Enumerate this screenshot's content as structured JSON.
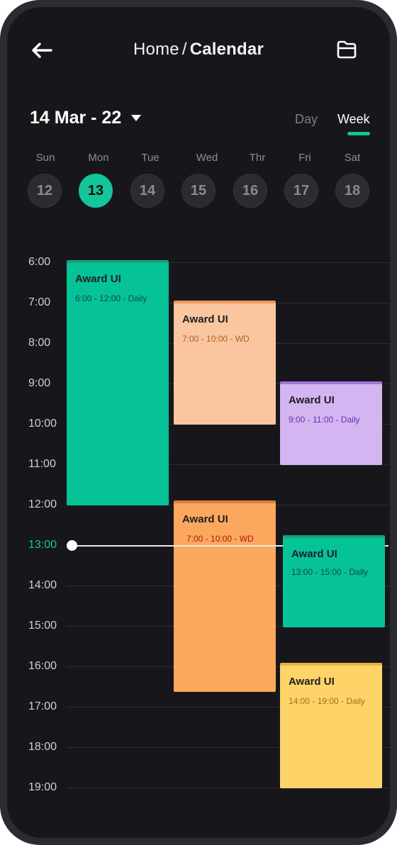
{
  "header": {
    "crumb_parent": "Home",
    "crumb_separator": "/",
    "crumb_current": "Calendar",
    "back_icon": "arrow-left-icon",
    "folder_icon": "folder-icon"
  },
  "range_label": "14 Mar - 22",
  "view_toggle": {
    "day": "Day",
    "week": "Week",
    "selected": "Week"
  },
  "week": {
    "days": [
      "Sun",
      "Mon",
      "Tue",
      "Wed",
      "Thr",
      "Fri",
      "Sat"
    ],
    "dates": [
      "12",
      "13",
      "14",
      "15",
      "16",
      "17",
      "18"
    ],
    "selected_date": "13"
  },
  "timeline": {
    "hours": [
      "6:00",
      "7:00",
      "8:00",
      "9:00",
      "10:00",
      "11:00",
      "12:00",
      "13:00",
      "14:00",
      "15:00",
      "16:00",
      "17:00",
      "18:00",
      "19:00"
    ],
    "current_time": "13:00"
  },
  "events": [
    {
      "title": "Award UI",
      "time": "6:00 - 12:00 - Daily",
      "color": "#05c396"
    },
    {
      "title": "Award UI",
      "time": "7:00 - 10:00 - WD",
      "color": "#f9c69f"
    },
    {
      "title": "Award UI",
      "time": "9:00 - 11:00 - Daily",
      "color": "#d3b5f1"
    },
    {
      "title": "Award UI",
      "time": "7:00 - 10:00 - WD",
      "color": "#fba75e"
    },
    {
      "title": "Award UI",
      "time": "13:00 - 15:00 - Daily",
      "color": "#05c396"
    },
    {
      "title": "Award UI",
      "time": "14:00 - 19:00 - Daily",
      "color": "#fed468"
    }
  ],
  "colors": {
    "accent": "#14c49a",
    "background": "#17171b"
  }
}
